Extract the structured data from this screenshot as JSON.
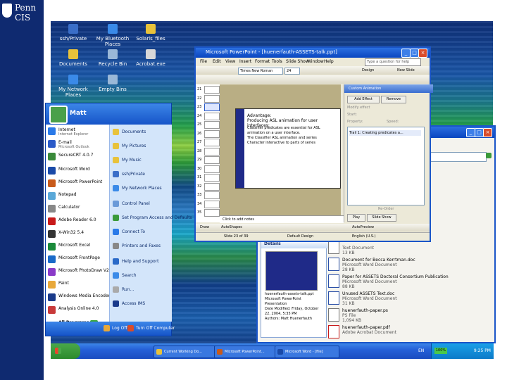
{
  "logo": {
    "line1": "Penn",
    "line2": "CIS"
  },
  "desktop_icons": [
    {
      "label": "ssh/Private",
      "color": "#3a6ec8"
    },
    {
      "label": "My Bluetooth Places",
      "color": "#3a8ae8"
    },
    {
      "label": "Solaris_files",
      "color": "#e8c23a"
    },
    {
      "label": "Documents",
      "color": "#e8c23a"
    },
    {
      "label": "Recycle Bin",
      "color": "#9ab8d8"
    },
    {
      "label": "Acrobat.exe",
      "color": "#d8d8d8"
    },
    {
      "label": "My Network Places",
      "color": "#3a8ae8"
    },
    {
      "label": "Empty Bins",
      "color": "#9ab8d8"
    }
  ],
  "start_menu": {
    "user": "Matt",
    "pinned": [
      {
        "label": "Internet",
        "sub": "Internet Explorer",
        "color": "#2a7ae8"
      },
      {
        "label": "E-mail",
        "sub": "Microsoft Outlook",
        "color": "#2a5ac8"
      },
      {
        "label": "SecureCRT 4.0.7",
        "sub": "",
        "color": "#3a8a3a"
      }
    ],
    "recent": [
      {
        "label": "Microsoft Word",
        "color": "#1a4aa8"
      },
      {
        "label": "Microsoft PowerPoint",
        "color": "#c85a1a"
      },
      {
        "label": "Notepad",
        "color": "#5aa8d8"
      },
      {
        "label": "Calculator",
        "color": "#888888"
      },
      {
        "label": "Adobe Reader 6.0",
        "color": "#c81a1a"
      },
      {
        "label": "X-Win32 5.4",
        "color": "#333333"
      },
      {
        "label": "Microsoft Excel",
        "color": "#1a8a3a"
      },
      {
        "label": "Microsoft FrontPage",
        "color": "#1a6ac8"
      },
      {
        "label": "Microsoft PhotoDraw V2",
        "color": "#8a3ac8"
      },
      {
        "label": "Paint",
        "color": "#e8a83a"
      },
      {
        "label": "Windows Media Encoder",
        "color": "#1a3a8a"
      },
      {
        "label": "Analysis Online 4.0",
        "color": "#c83a3a"
      }
    ],
    "all_programs": "All Programs",
    "right_items": [
      {
        "label": "Documents",
        "color": "#e8c23a"
      },
      {
        "label": "My Pictures",
        "color": "#e8c23a"
      },
      {
        "label": "My Music",
        "color": "#e8c23a"
      },
      {
        "label": "ssh/Private",
        "color": "#3a6ec8"
      },
      {
        "label": "My Network Places",
        "color": "#3a8ae8"
      },
      {
        "label": "Control Panel",
        "color": "#6a9ad8"
      },
      {
        "label": "Set Program Access and Defaults",
        "color": "#3a9a3a"
      },
      {
        "label": "Connect To",
        "color": "#2a7ae8"
      },
      {
        "label": "Printers and Faxes",
        "color": "#888888"
      },
      {
        "label": "Help and Support",
        "color": "#2a6ac8"
      },
      {
        "label": "Search",
        "color": "#3a8ae8"
      },
      {
        "label": "Run...",
        "color": "#aaaaaa"
      },
      {
        "label": "Access IMS",
        "color": "#1a3a8a"
      }
    ],
    "log_off": "Log Off",
    "turn_off": "Turn Off Computer"
  },
  "powerpoint": {
    "title": "Microsoft PowerPoint - [huenerfauth-ASSETS-talk.ppt]",
    "menu": [
      "File",
      "Edit",
      "View",
      "Insert",
      "Format",
      "Tools",
      "Slide Show",
      "Window",
      "Help"
    ],
    "help_placeholder": "Type a question for help",
    "font": "Times New Roman",
    "font_size": "24",
    "design": "Design",
    "new_slide": "New Slide",
    "slide_numbers": [
      "21",
      "22",
      "23",
      "24",
      "25",
      "26",
      "27",
      "28",
      "29",
      "30",
      "31",
      "32",
      "33",
      "34",
      "35"
    ],
    "slide": {
      "title_line1": "Advantage:",
      "title_line2": "Producing ASL animation for user interfaces:",
      "bullets": [
        "Classifier predicates are essential for ASL animation on a user interface.",
        "The Classifier ASL animation and series",
        "Character interactive to parts of series"
      ]
    },
    "notes": "Click to add notes",
    "taskpane": {
      "title": "Custom Animation",
      "add_effect": "Add Effect",
      "remove": "Remove",
      "modify": "Modify effect",
      "start": "Start:",
      "property": "Property:",
      "speed": "Speed:",
      "item": "Trail 1: Creating predicates a...",
      "reorder": "Re-Order",
      "play": "Play",
      "slideshow": "Slide Show",
      "autopreview": "AutoPreview"
    },
    "draw": {
      "draw": "Draw",
      "autoshapes": "AutoShapes"
    },
    "status": {
      "slide": "Slide 23 of 39",
      "design": "Default Design",
      "lang": "English (U.S.)"
    }
  },
  "explorer": {
    "address_suffix": "oughts",
    "details": {
      "header": "Details",
      "file": "huenerfauth-assets-talk.ppt",
      "type": "Microsoft PowerPoint Presentation",
      "modified": "Date Modified: Friday, October 22, 2004, 5:35 PM",
      "authors": "Authors: Matt Huenerfauth"
    },
    "files": [
      {
        "name": "",
        "type": "Text Document",
        "size": "13 KB",
        "kind": "txt"
      },
      {
        "name": "Document for Becca Kerrtman.doc",
        "type": "Microsoft Word Document",
        "size": "28 KB",
        "kind": "word"
      },
      {
        "name": "Paper for ASSETS Doctoral Consortium Publication",
        "type": "Microsoft Word Document",
        "size": "88 KB",
        "kind": "word"
      },
      {
        "name": "Unused ASSETS Text.doc",
        "type": "Microsoft Word Document",
        "size": "31 KB",
        "kind": "word"
      },
      {
        "name": "huenerfauth-paper.ps",
        "type": "PS File",
        "size": "1,094 KB",
        "kind": "txt"
      },
      {
        "name": "huenerfauth-paper.pdf",
        "type": "Adobe Acrobat Document",
        "size": "",
        "kind": "pdf"
      }
    ]
  },
  "taskbar": {
    "start": "start",
    "tasks": [
      {
        "label": "Current Working Do...",
        "color": "#e8c23a"
      },
      {
        "label": "Microsoft PowerPoint...",
        "color": "#c85a1a"
      },
      {
        "label": "Microsoft Word - [file]",
        "color": "#1a4aa8"
      }
    ],
    "lang": "EN",
    "battery": "100%",
    "clock": "9:25 PM"
  }
}
